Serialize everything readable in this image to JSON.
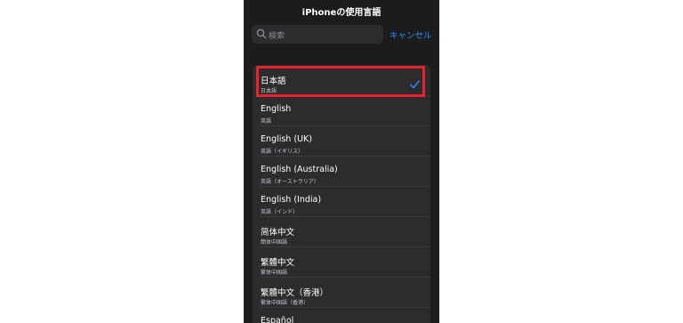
{
  "header": {
    "title": "iPhoneの使用言語"
  },
  "search": {
    "placeholder": "検索",
    "cancel_label": "キャンセル"
  },
  "languages": [
    {
      "title": "日本語",
      "subtitle": "日本語",
      "selected": true
    },
    {
      "title": "English",
      "subtitle": "英語",
      "selected": false
    },
    {
      "title": "English (UK)",
      "subtitle": "英語（イギリス）",
      "selected": false
    },
    {
      "title": "English (Australia)",
      "subtitle": "英語（オーストラリア）",
      "selected": false
    },
    {
      "title": "English (India)",
      "subtitle": "英語（インド）",
      "selected": false
    },
    {
      "title": "简体中文",
      "subtitle": "簡体中国語",
      "selected": false
    },
    {
      "title": "繁體中文",
      "subtitle": "繁体中国語",
      "selected": false
    },
    {
      "title": "繁體中文（香港）",
      "subtitle": "繁体中国語（香港）",
      "selected": false
    },
    {
      "title": "Español",
      "subtitle": "",
      "selected": false
    }
  ],
  "colors": {
    "background": "#1c1c1e",
    "cell": "#2c2c2e",
    "accent": "#2f8cff",
    "highlight": "#e8232a"
  }
}
